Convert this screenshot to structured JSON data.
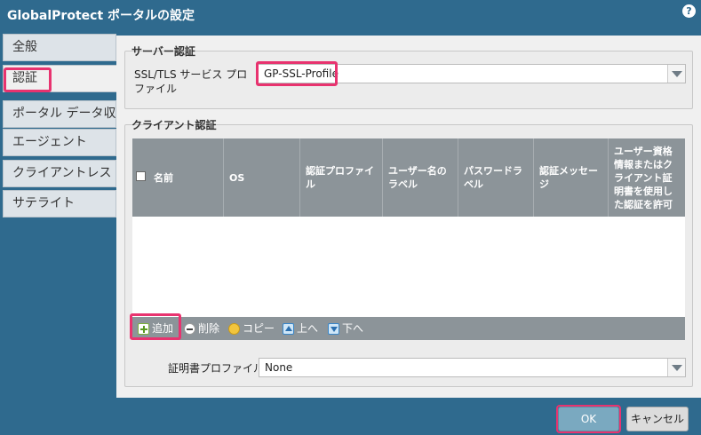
{
  "window": {
    "title": "GlobalProtect ポータルの設定",
    "help_icon": "?"
  },
  "sidebar": {
    "items": [
      {
        "label": "全般"
      },
      {
        "label": "認証"
      },
      {
        "label": "ポータル データ収集"
      },
      {
        "label": "エージェント"
      },
      {
        "label": "クライアントレス VPN"
      },
      {
        "label": "サテライト"
      }
    ],
    "active_index": 1
  },
  "server_auth": {
    "legend": "サーバー認証",
    "ssl_label": "SSL/TLS サービス プロファイル",
    "ssl_value": "GP-SSL-Profile"
  },
  "client_auth": {
    "legend": "クライアント認証",
    "columns": [
      "名前",
      "OS",
      "認証プロファイル",
      "ユーザー名の ラベル",
      "パスワードラベル",
      "認証メッセージ",
      "ユーザー資格情報またはクライアント証明書を使用した認証を許可"
    ],
    "rows": [],
    "toolbar": {
      "add": "追加",
      "delete": "削除",
      "copy": "コピー",
      "up": "上へ",
      "down": "下へ"
    },
    "cert_profile_label": "証明書プロファイル",
    "cert_profile_value": "None"
  },
  "footer": {
    "ok": "OK",
    "cancel": "キャンセル"
  },
  "colors": {
    "accent_highlight": "#e8336f",
    "titlebar": "#2f6a8e",
    "grid_header": "#8c9499"
  }
}
